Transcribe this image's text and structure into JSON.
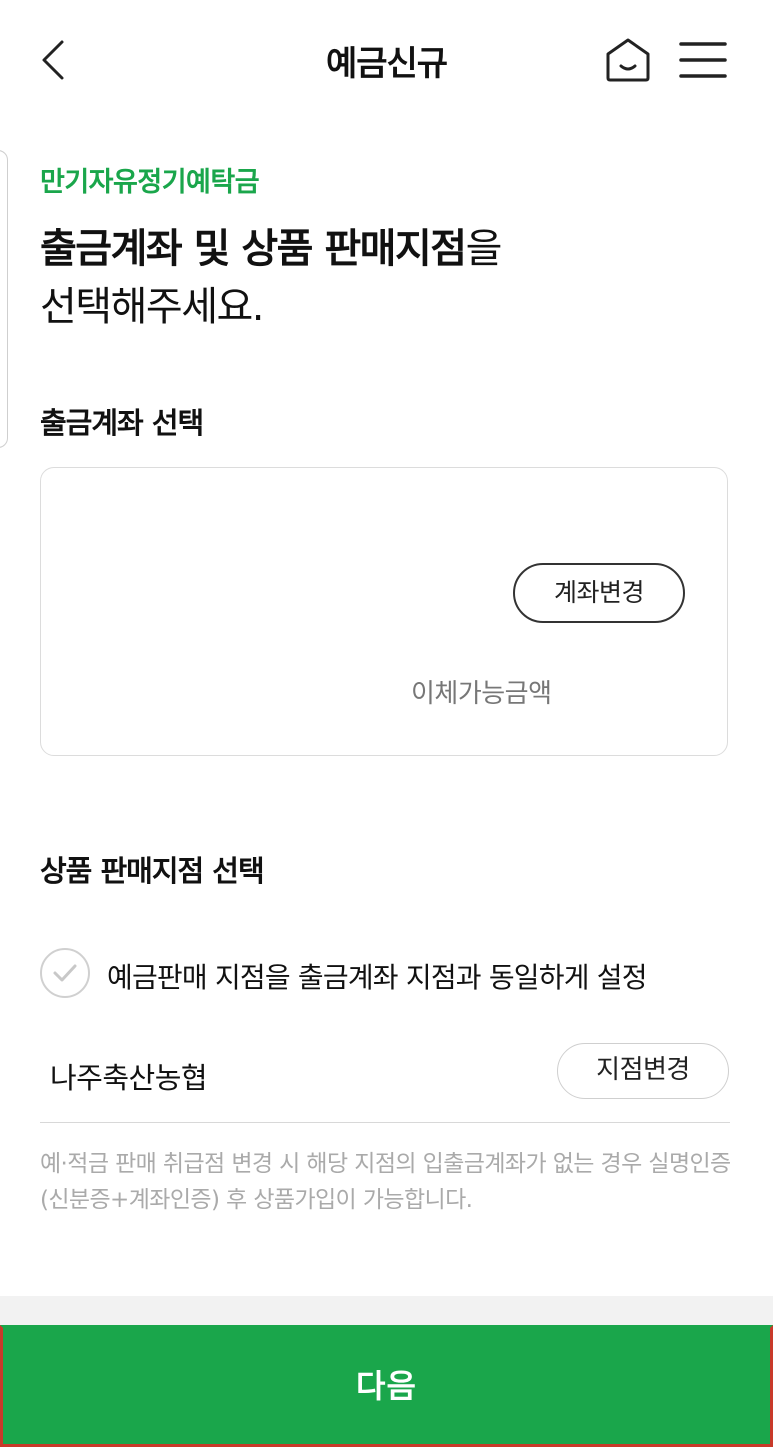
{
  "header": {
    "title": "예금신규",
    "icons": {
      "back": "chevron-left-icon",
      "home": "home-icon",
      "menu": "hamburger-menu-icon"
    }
  },
  "product": {
    "name": "만기자유정기예탁금"
  },
  "headline": {
    "line1_bold": "출금계좌 및 상품 판매지점",
    "line1_rest": "을",
    "line2": "선택해주세요."
  },
  "account_section": {
    "label": "출금계좌 선택",
    "change_button": "계좌변경",
    "available_label": "이체가능금액"
  },
  "branch_section": {
    "label": "상품 판매지점 선택",
    "same_branch_checkbox": "예금판매 지점을 출금계좌 지점과 동일하게 설정",
    "branch_name": "나주축산농협",
    "change_button": "지점변경",
    "notice": "예·적금 판매 취급점 변경 시 해당 지점의 입출금계좌가 없는 경우 실명인증(신분증+계좌인증) 후 상품가입이 가능합니다."
  },
  "footer": {
    "next_button": "다음"
  },
  "colors": {
    "accent": "#1aa64b",
    "muted_text": "#aaaaaa",
    "highlight_border": "#c83a2a"
  }
}
